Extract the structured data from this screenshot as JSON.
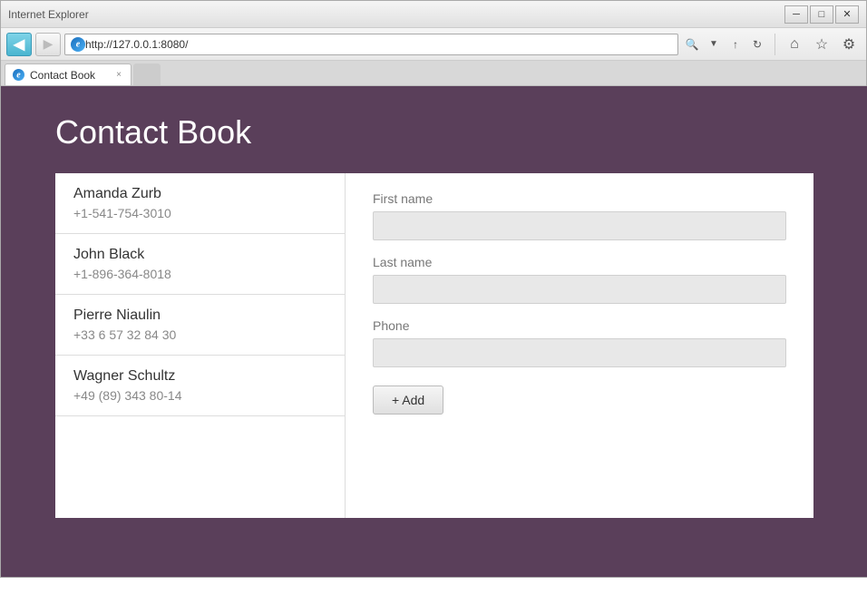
{
  "window": {
    "title_bar_buttons": {
      "minimize": "─",
      "maximize": "□",
      "close": "✕"
    }
  },
  "nav": {
    "back_arrow": "◀",
    "forward_arrow": "▶",
    "address": "http://127.0.0.1:8080/",
    "search_icon": "🔍",
    "share_icon": "↑",
    "refresh_icon": "↻",
    "home_icon": "⌂",
    "favorites_icon": "☆",
    "settings_icon": "⚙"
  },
  "tab": {
    "label": "Contact Book",
    "close": "×"
  },
  "page": {
    "title": "Contact Book"
  },
  "contacts": [
    {
      "name": "Amanda Zurb",
      "phone": "+1-541-754-3010"
    },
    {
      "name": "John Black",
      "phone": "+1-896-364-8018"
    },
    {
      "name": "Pierre Niaulin",
      "phone": "+33 6 57 32 84 30"
    },
    {
      "name": "Wagner Schultz",
      "phone": "+49 (89) 343 80-14"
    }
  ],
  "form": {
    "first_name_label": "First name",
    "last_name_label": "Last name",
    "phone_label": "Phone",
    "add_button_label": "+ Add"
  }
}
